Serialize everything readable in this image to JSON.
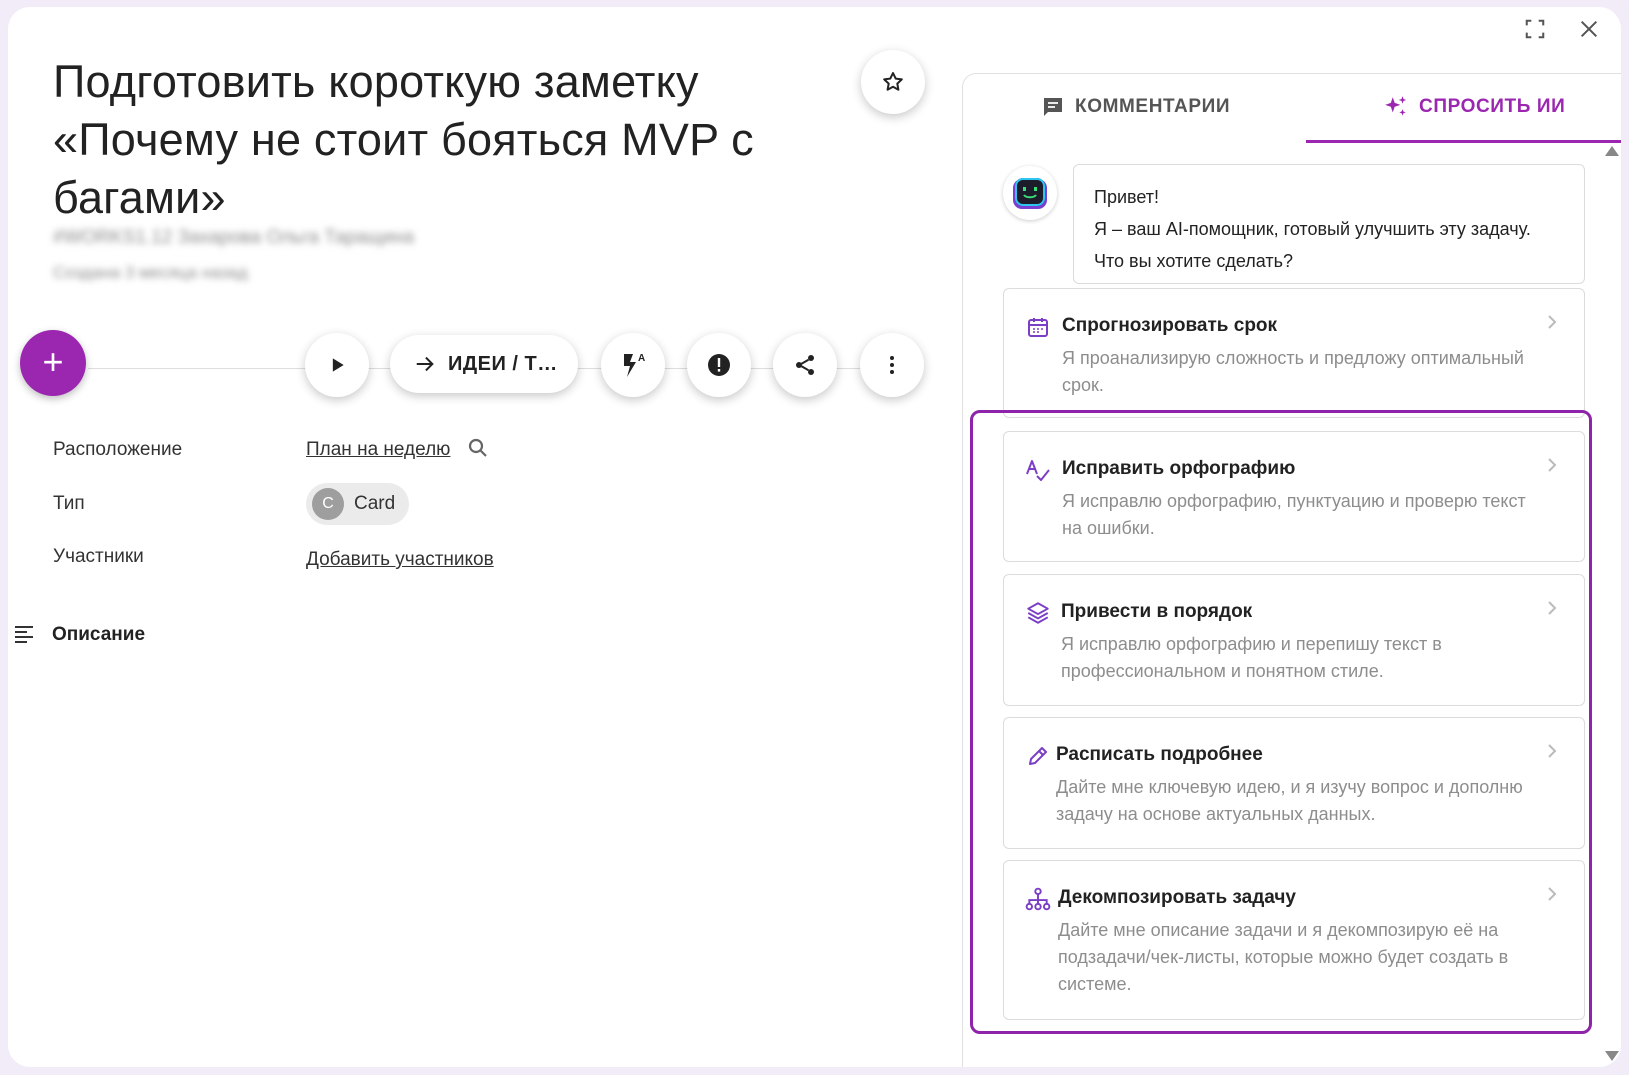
{
  "task": {
    "title": "Подготовить короткую заметку «Почему не стоит бояться MVP с багами»",
    "meta_blurred": "#WORKS1.12 Захарова Ольга Таращина",
    "created_blurred": "Создана 3 месяца назад"
  },
  "toolbar": {
    "add_label": "+",
    "status_label": "ИДЕИ / Т…"
  },
  "fields": {
    "location_label": "Расположение",
    "location_value": "План на неделю",
    "type_label": "Тип",
    "type_avatar": "C",
    "type_value": "Card",
    "participants_label": "Участники",
    "participants_value": "Добавить участников",
    "description_label": "Описание"
  },
  "panel": {
    "tab_comments": "КОММЕНТАРИИ",
    "tab_ai": "СПРОСИТЬ ИИ",
    "greeting_line1": "Привет!",
    "greeting_line2": "Я – ваш AI-помощник, готовый улучшить эту задачу. Что вы хотите сделать?",
    "actions": [
      {
        "title": "Спрогнозировать срок",
        "desc": "Я проанализирую сложность и предложу оптимальный срок.",
        "icon": "calendar-icon"
      },
      {
        "title": "Исправить орфографию",
        "desc": "Я исправлю орфографию, пунктуацию и проверю текст на ошибки.",
        "icon": "spellcheck-icon"
      },
      {
        "title": "Привести в порядок",
        "desc": "Я исправлю орфографию и перепишу текст в профессиональном и понятном стиле.",
        "icon": "layers-icon"
      },
      {
        "title": "Расписать подробнее",
        "desc": "Дайте мне ключевую идею, и я изучу вопрос и дополню задачу на основе актуальных данных.",
        "icon": "pencil-icon"
      },
      {
        "title": "Декомпозировать задачу",
        "desc": "Дайте мне описание задачи и я декомпозирую её на подзадачи/чек-листы, которые можно будет создать в системе.",
        "icon": "hierarchy-icon"
      }
    ]
  },
  "colors": {
    "accent": "#9b27b0",
    "highlight": "#8e24aa",
    "muted_text": "#8d8d8d"
  }
}
